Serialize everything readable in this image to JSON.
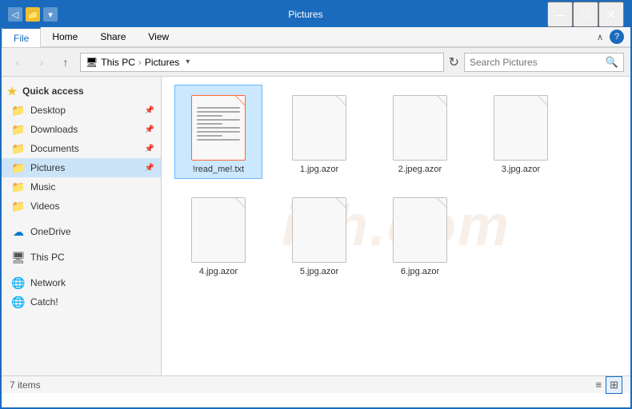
{
  "titleBar": {
    "title": "Pictures",
    "minimize": "—",
    "maximize": "□",
    "close": "✕"
  },
  "ribbon": {
    "tabs": [
      "File",
      "Home",
      "Share",
      "View"
    ],
    "activeTab": "File"
  },
  "addressBar": {
    "breadcrumb": [
      "This PC",
      "Pictures"
    ],
    "searchPlaceholder": "Search Pictures"
  },
  "sidebar": {
    "quickAccess": "Quick access",
    "items": [
      {
        "id": "desktop",
        "label": "Desktop",
        "icon": "📁",
        "pin": true
      },
      {
        "id": "downloads",
        "label": "Downloads",
        "icon": "📁",
        "pin": true
      },
      {
        "id": "documents",
        "label": "Documents",
        "icon": "📁",
        "pin": true
      },
      {
        "id": "pictures",
        "label": "Pictures",
        "icon": "📁",
        "pin": true,
        "active": true
      },
      {
        "id": "music",
        "label": "Music",
        "icon": "📁",
        "pin": false
      },
      {
        "id": "videos",
        "label": "Videos",
        "icon": "📁",
        "pin": false
      }
    ],
    "onedrive": "OneDrive",
    "thispc": "This PC",
    "network": "Network",
    "catch": "Catch!"
  },
  "files": [
    {
      "id": "f0",
      "name": "!read_me!.txt",
      "type": "txt",
      "selected": true
    },
    {
      "id": "f1",
      "name": "1.jpg.azor",
      "type": "generic",
      "selected": false
    },
    {
      "id": "f2",
      "name": "2.jpeg.azor",
      "type": "generic",
      "selected": false
    },
    {
      "id": "f3",
      "name": "3.jpg.azor",
      "type": "generic",
      "selected": false
    },
    {
      "id": "f4",
      "name": "4.jpg.azor",
      "type": "generic",
      "selected": false
    },
    {
      "id": "f5",
      "name": "5.jpg.azor",
      "type": "generic",
      "selected": false
    },
    {
      "id": "f6",
      "name": "6.jpg.azor",
      "type": "generic",
      "selected": false
    }
  ],
  "statusBar": {
    "itemCount": "7 items"
  }
}
